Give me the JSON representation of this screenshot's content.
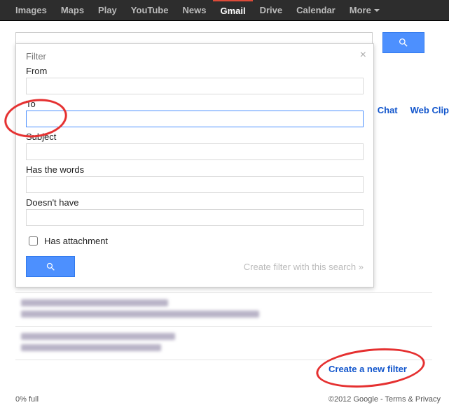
{
  "topnav": {
    "items": [
      {
        "label": "Images"
      },
      {
        "label": "Maps"
      },
      {
        "label": "Play"
      },
      {
        "label": "YouTube"
      },
      {
        "label": "News"
      },
      {
        "label": "Gmail",
        "active": true
      },
      {
        "label": "Drive"
      },
      {
        "label": "Calendar"
      }
    ],
    "more_label": "More"
  },
  "filter": {
    "title": "Filter",
    "from_label": "From",
    "to_label": "To",
    "subject_label": "Subject",
    "haswords_label": "Has the words",
    "doesnthave_label": "Doesn't have",
    "attachment_label": "Has attachment",
    "create_link": "Create filter with this search »",
    "from_value": "",
    "to_value": "",
    "subject_value": "",
    "haswords_value": "",
    "doesnthave_value": "",
    "attachment_checked": false
  },
  "right_tabs": {
    "chat": "Chat",
    "webclips": "Web Clip"
  },
  "bottom_link": "Create a new filter",
  "footer": {
    "storage": "0% full",
    "copyright": "©2012 Google - ",
    "terms": "Terms & Privacy"
  }
}
